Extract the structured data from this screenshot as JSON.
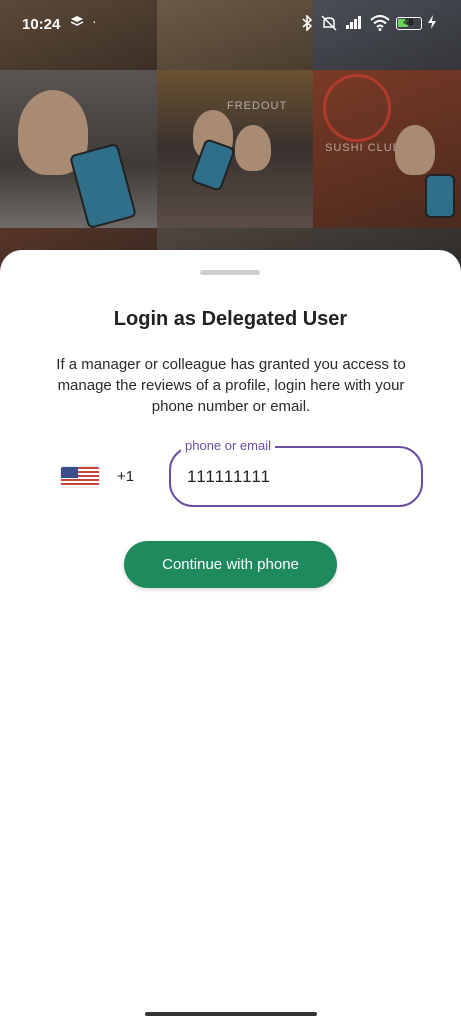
{
  "status_bar": {
    "time": "10:24",
    "battery_level": "48",
    "battery_fraction": 0.48,
    "icons": [
      "layers-icon",
      "bluetooth-icon",
      "mute-icon",
      "signal-icon",
      "wifi-icon",
      "charging-icon"
    ]
  },
  "background": {
    "tile_captions": [
      "SUSHI CLUB",
      "FREDOUT"
    ]
  },
  "login": {
    "title": "Login as Delegated User",
    "description": "If a manager or colleague has granted you access to manage the reviews of a profile, login here with your phone number or email.",
    "country_flag": "us-flag",
    "dial_code": "+1",
    "input_label": "phone or email",
    "input_value": "111111111",
    "continue_label": "Continue with phone"
  },
  "colors": {
    "accent": "#6a4fa0",
    "button": "#1e8a5e"
  }
}
